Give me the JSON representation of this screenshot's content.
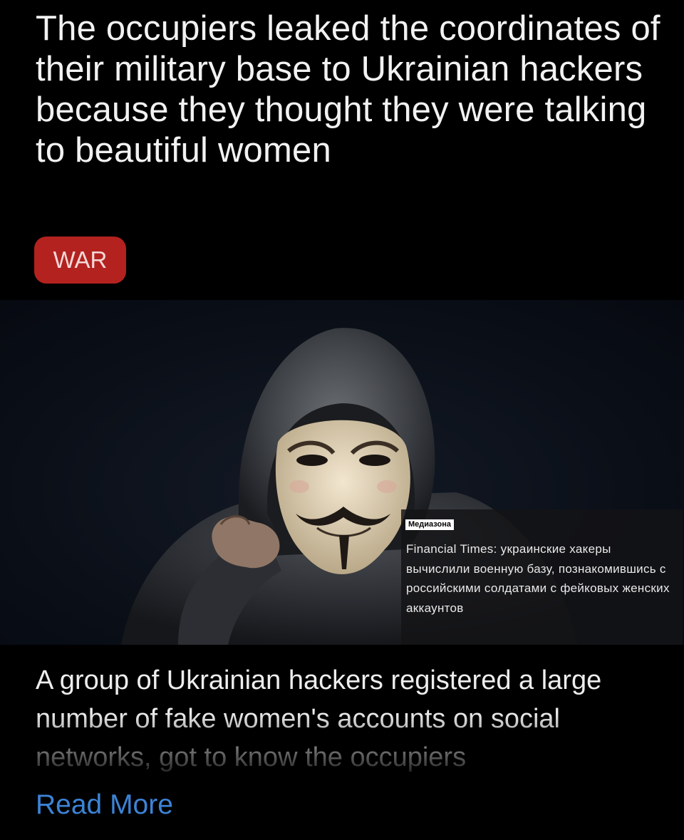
{
  "article": {
    "headline": "The occupiers leaked the coordinates of their military base to Ukrainian hackers because they thought they were talking to beautiful women",
    "tag": "WAR",
    "summary": "A group of Ukrainian hackers registered a large number of fake women's accounts on social networks, got to know the occupiers",
    "read_more": "Read More"
  },
  "image_overlay": {
    "source": "Медиазона",
    "caption": "Financial Times: украинские хакеры вычислили военную базу, познакомившись с российскими солдатами с фейковых женских аккаунтов"
  },
  "colors": {
    "background": "#000000",
    "tag_background": "#b3221f",
    "link": "#3c83d6"
  }
}
